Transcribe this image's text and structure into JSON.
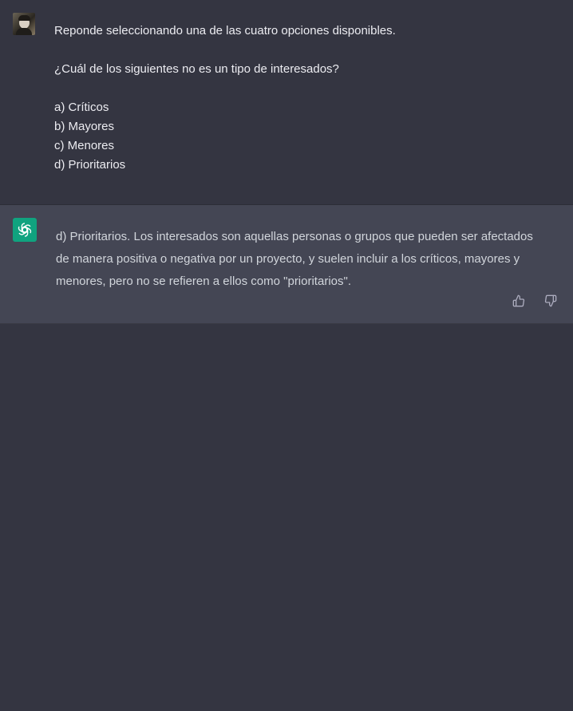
{
  "user_message": {
    "lines": [
      "Reponde seleccionando una de las cuatro opciones disponibles.",
      "¿Cuál de los siguientes no es un tipo de interesados?",
      "a) Críticos",
      "b) Mayores",
      "c) Menores",
      "d) Prioritarios"
    ]
  },
  "assistant_message": {
    "lines": [
      "d) Prioritarios. Los interesados son aquellas personas o grupos que pueden ser afectados",
      "de manera positiva o negativa por un proyecto, y suelen incluir a los críticos, mayores y",
      "menores, pero no se refieren a ellos como \"prioritarios\"."
    ]
  },
  "icons": {
    "user_avatar": "user-avatar-photo",
    "assistant_avatar": "openai-logo-icon",
    "thumb_up": "thumbs-up-icon",
    "thumb_down": "thumbs-down-icon"
  },
  "colors": {
    "background": "#343541",
    "assistant_background": "#444654",
    "assistant_avatar_bg": "#10a37f",
    "user_text": "#ececf1",
    "assistant_text": "#d1d5db",
    "icon": "#acacbe"
  }
}
